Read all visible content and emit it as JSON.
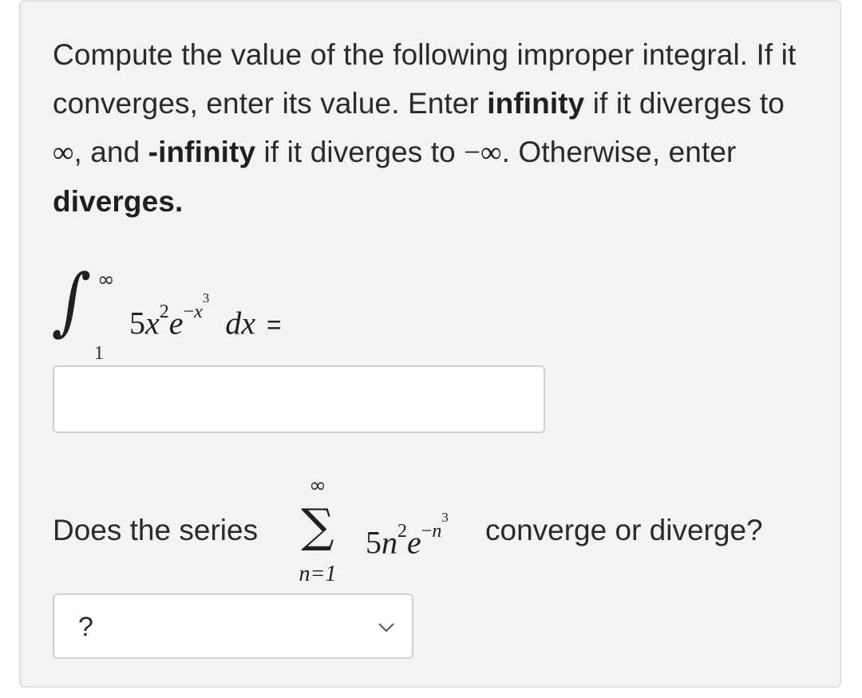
{
  "question": {
    "p1": "Compute the value of the following improper integral. If it converges, enter its value. Enter ",
    "b1": "infinity",
    "p2": " if it diverges to ",
    "inf1": "∞",
    "p3": ", and ",
    "b2": "-infinity",
    "p4": " if it diverges to ",
    "neginf": "−∞",
    "p5": ". Otherwise, enter ",
    "b3": "diverges."
  },
  "integral": {
    "upper": "∞",
    "lower": "1",
    "coef": "5",
    "var": "x",
    "pow": "2",
    "base": "e",
    "exp_sign": "−",
    "exp_var": "x",
    "exp_pow": "3",
    "dx": "dx",
    "equals": "="
  },
  "answer_input": {
    "value": "",
    "placeholder": ""
  },
  "series": {
    "pre": "Does the series",
    "top": "∞",
    "sigma": "∑",
    "bottom": "n=1",
    "coef": "5",
    "var": "n",
    "pow": "2",
    "base": "e",
    "exp_sign": "−",
    "exp_var": "n",
    "exp_pow": "3",
    "post": "converge or diverge?"
  },
  "select": {
    "selected": "?"
  },
  "icons": {
    "dropdown": "chevron-down-icon"
  },
  "colors": {
    "card_bg": "#f3f3f3",
    "border": "#cfcfcf",
    "text": "#2a2a2a"
  }
}
